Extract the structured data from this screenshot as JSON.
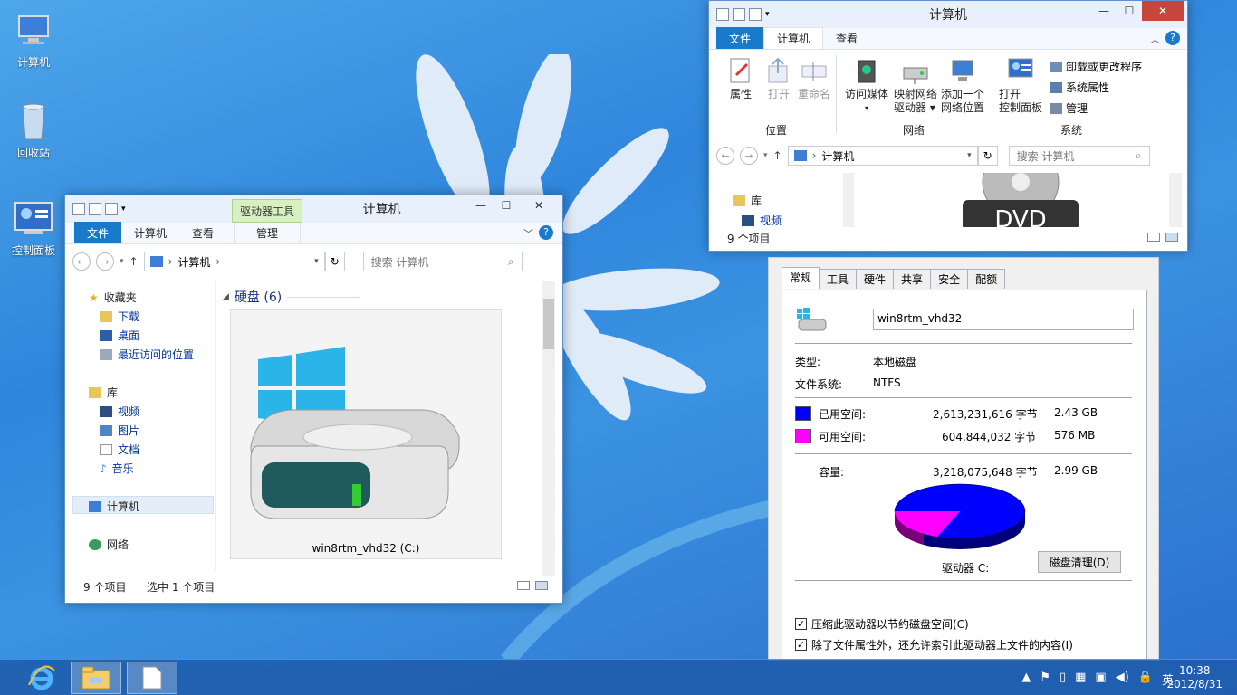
{
  "desktop": {
    "icons": [
      {
        "label": "计算机",
        "icon": "computer-icon"
      },
      {
        "label": "回收站",
        "icon": "recycle-bin-icon"
      },
      {
        "label": "控制面板",
        "icon": "control-panel-icon"
      }
    ]
  },
  "explorer_top": {
    "title": "计算机",
    "tabs": [
      "文件",
      "计算机",
      "查看"
    ],
    "ribbon": {
      "location": {
        "group": "位置",
        "items": [
          "属性",
          "打开",
          "重命名"
        ]
      },
      "network": {
        "group": "网络",
        "items": [
          "访问媒体",
          "映射网络\n驱动器 ▾",
          "添加一个\n网络位置"
        ]
      },
      "system": {
        "group": "系统",
        "open_cp": "打开\n控制面板",
        "side": [
          "卸载或更改程序",
          "系统属性",
          "管理"
        ]
      }
    },
    "address": "计算机",
    "search_placeholder": "搜索 计算机",
    "nav": [
      "库",
      "视频"
    ],
    "status": "9 个项目",
    "dvd_text": "DVD"
  },
  "explorer_main": {
    "title": "计算机",
    "context_tab": "驱动器工具",
    "tabs": [
      "文件",
      "计算机",
      "查看",
      "管理"
    ],
    "address": "计算机",
    "search_placeholder": "搜索 计算机",
    "nav": {
      "favorites": "收藏夹",
      "fav_items": [
        "下载",
        "桌面",
        "最近访问的位置"
      ],
      "libraries": "库",
      "lib_items": [
        "视频",
        "图片",
        "文档",
        "音乐"
      ],
      "computer": "计算机",
      "network": "网络"
    },
    "group_header": "硬盘 (6)",
    "drive_label": "win8rtm_vhd32 (C:)",
    "status_items": "9 个项目",
    "status_selected": "选中 1 个项目"
  },
  "properties": {
    "tabs": [
      "常规",
      "工具",
      "硬件",
      "共享",
      "安全",
      "配额"
    ],
    "name": "win8rtm_vhd32",
    "type_label": "类型:",
    "type_value": "本地磁盘",
    "fs_label": "文件系统:",
    "fs_value": "NTFS",
    "used_label": "已用空间:",
    "used_bytes": "2,613,231,616 字节",
    "used_size": "2.43 GB",
    "free_label": "可用空间:",
    "free_bytes": "604,844,032 字节",
    "free_size": "576 MB",
    "cap_label": "容量:",
    "cap_bytes": "3,218,075,648 字节",
    "cap_size": "2.99 GB",
    "drive_label": "驱动器 C:",
    "cleanup_button": "磁盘清理(D)",
    "compress_label": "压缩此驱动器以节约磁盘空间(C)",
    "index_label": "除了文件属性外，还允许索引此驱动器上文件的内容(I)",
    "used_fraction": 0.812,
    "colors": {
      "used": "#0000ff",
      "free": "#ff00ff"
    }
  },
  "taskbar": {
    "clock_time": "10:38",
    "clock_date": "2012/8/31",
    "ime": "英"
  }
}
